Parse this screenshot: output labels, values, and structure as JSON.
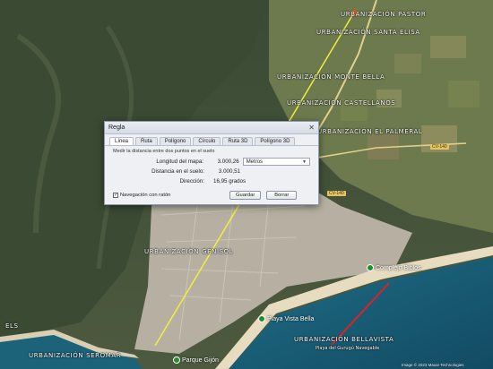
{
  "map": {
    "place_labels": [
      "URBANIZACIÓN PASTOR",
      "URBANIZACIÓN SANTA ELISA",
      "URBANIZACIÓN MONTE BELLA",
      "URBANIZACIÓN CASTELLANOS",
      "URBANIZACIÓN EL PALMERAL",
      "URBANIZACIÓN GENISOL",
      "URBANIZACIÓN BELLAVISTA",
      "URBANIZACIÓN SEROMAR",
      "ELS"
    ],
    "poi_labels": [
      "Complejo Biblos",
      "Playa Vista Bella",
      "Parque Gijón"
    ],
    "water_label": "Playa del Gurugú Navegable",
    "road_badges": [
      "CV-140",
      "CV-140"
    ],
    "copyright": "Image © 2023 Maxar Technologies"
  },
  "dialog": {
    "title": "Regla",
    "close": "✕",
    "tabs": [
      "Línea",
      "Ruta",
      "Polígono",
      "Círculo",
      "Ruta 3D",
      "Polígono 3D"
    ],
    "description": "Medir la distancia entre dos puntos en el suelo",
    "rows": {
      "map_length_label": "Longitud del mapa:",
      "map_length_value": "3.000,26",
      "ground_length_label": "Distancia en el suelo:",
      "ground_length_value": "3.000,51",
      "direction_label": "Dirección:",
      "direction_value": "16,95 grados"
    },
    "unit_select": "Metros",
    "mouse_nav_label": "Navegación con ratón",
    "save_label": "Guardar",
    "clear_label": "Borrar"
  }
}
